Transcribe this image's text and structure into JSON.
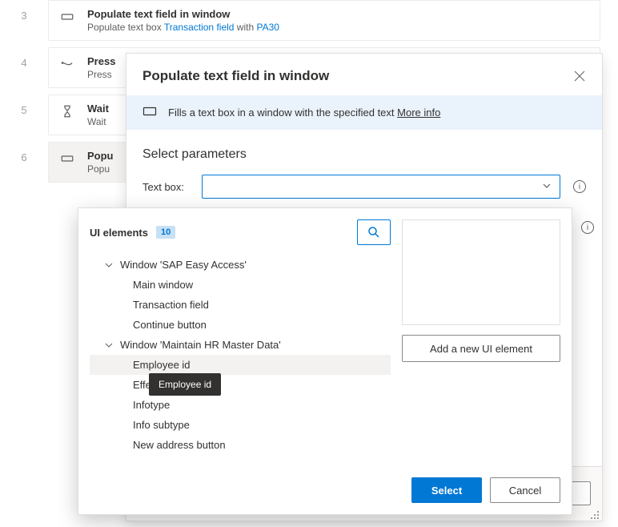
{
  "steps": [
    {
      "num": "3",
      "title": "Populate text field in window",
      "sub_pre": "Populate text box ",
      "sub_link1": "Transaction field",
      "sub_mid": " with ",
      "sub_link2": "PA30"
    },
    {
      "num": "4",
      "title": "Press",
      "sub": "Press"
    },
    {
      "num": "5",
      "title": "Wait",
      "sub": "Wait"
    },
    {
      "num": "6",
      "title": "Popu",
      "sub": "Popu"
    }
  ],
  "modal": {
    "title": "Populate text field in window",
    "info_text": "Fills a text box in a window with the specified text ",
    "more_info": "More info",
    "section": "Select parameters",
    "param_label": "Text box:"
  },
  "picker": {
    "heading": "UI elements",
    "count": "10",
    "groups": [
      {
        "label": "Window 'SAP Easy Access'",
        "children": [
          {
            "label": "Main window"
          },
          {
            "label": "Transaction field"
          },
          {
            "label": "Continue button"
          }
        ]
      },
      {
        "label": "Window 'Maintain HR Master Data'",
        "children": [
          {
            "label": "Employee id",
            "selected": true
          },
          {
            "label": "Effecti"
          },
          {
            "label": "Infotype"
          },
          {
            "label": "Info subtype"
          },
          {
            "label": "New address button"
          }
        ]
      }
    ],
    "add_label": "Add a new UI element",
    "select_label": "Select",
    "cancel_label": "Cancel"
  },
  "tooltip": {
    "text": "Employee id"
  }
}
